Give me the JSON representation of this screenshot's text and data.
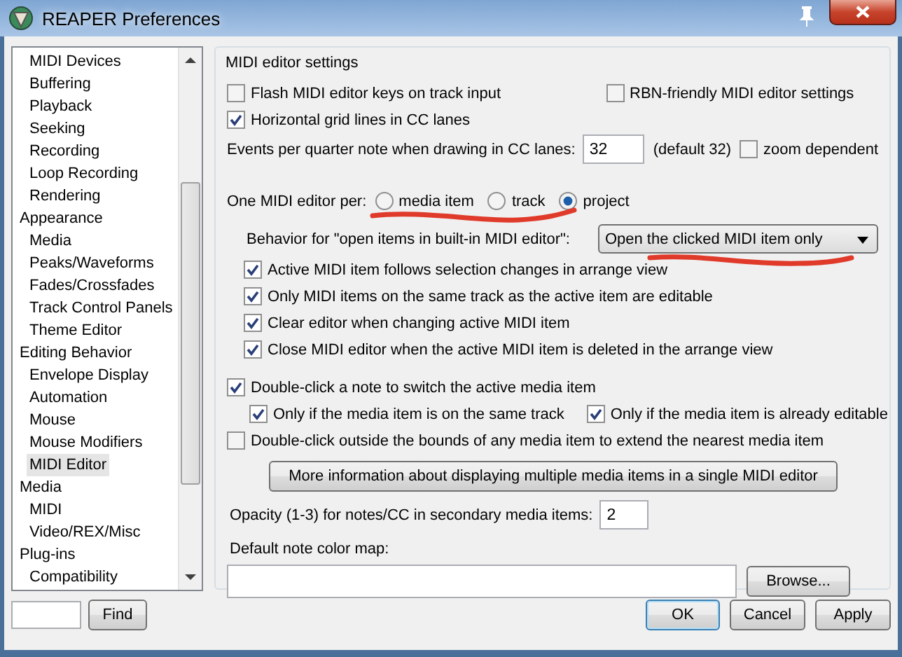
{
  "window": {
    "title": "REAPER Preferences"
  },
  "tree": [
    {
      "children": [
        {
          "label": "MIDI Devices",
          "selected": false
        },
        {
          "label": "Buffering",
          "selected": false
        },
        {
          "label": "Playback",
          "selected": false
        },
        {
          "label": "Seeking",
          "selected": false
        },
        {
          "label": "Recording",
          "selected": false
        },
        {
          "label": "Loop Recording",
          "selected": false
        },
        {
          "label": "Rendering",
          "selected": false
        }
      ]
    },
    {
      "label": "Appearance",
      "selected": false,
      "children": [
        {
          "label": "Media",
          "selected": false
        },
        {
          "label": "Peaks/Waveforms",
          "selected": false
        },
        {
          "label": "Fades/Crossfades",
          "selected": false
        },
        {
          "label": "Track Control Panels",
          "selected": false
        },
        {
          "label": "Theme Editor",
          "selected": false
        }
      ]
    },
    {
      "label": "Editing Behavior",
      "selected": false,
      "children": [
        {
          "label": "Envelope Display",
          "selected": false
        },
        {
          "label": "Automation",
          "selected": false
        },
        {
          "label": "Mouse",
          "selected": false
        },
        {
          "label": "Mouse Modifiers",
          "selected": false
        },
        {
          "label": "MIDI Editor",
          "selected": true
        }
      ]
    },
    {
      "label": "Media",
      "selected": false,
      "children": [
        {
          "label": "MIDI",
          "selected": false
        },
        {
          "label": "Video/REX/Misc",
          "selected": false
        }
      ]
    },
    {
      "label": "Plug-ins",
      "selected": false,
      "children": [
        {
          "label": "Compatibility",
          "selected": false
        }
      ]
    }
  ],
  "find": {
    "button": "Find"
  },
  "group": {
    "title": "MIDI editor settings"
  },
  "settings": [
    {
      "kind": "checks",
      "items": [
        {
          "label": "Flash MIDI editor keys on track input",
          "checked": false
        },
        {
          "label": "RBN-friendly MIDI editor settings",
          "checked": false
        }
      ]
    },
    {
      "kind": "checks",
      "items": [
        {
          "label": "Horizontal grid lines in CC lanes",
          "checked": true
        }
      ]
    },
    {
      "kind": "number",
      "label": "Events per quarter note when drawing in CC lanes:",
      "value": "32",
      "note": "(default 32)",
      "option": {
        "label": "zoom dependent",
        "checked": false
      }
    },
    {
      "kind": "radios",
      "label": "One MIDI editor per:",
      "options": [
        {
          "label": "media item",
          "selected": false
        },
        {
          "label": "track",
          "selected": false
        },
        {
          "label": "project",
          "selected": true
        }
      ]
    },
    {
      "kind": "dropdown",
      "label": "Behavior for \"open items in built-in MIDI editor\":",
      "value": "Open the clicked MIDI item only",
      "children": [
        {
          "label": "Active MIDI item follows selection changes in arrange view",
          "checked": true
        },
        {
          "label": "Only MIDI items on the same track as the active item are editable",
          "checked": true
        },
        {
          "label": "Clear editor when changing active MIDI item",
          "checked": true
        },
        {
          "label": "Close MIDI editor when the active MIDI item is deleted in the arrange view",
          "checked": true
        }
      ]
    },
    {
      "kind": "checks",
      "items": [
        {
          "label": "Double-click a note to switch the active media item",
          "checked": true,
          "children": [
            {
              "label": "Only if the media item is on the same track",
              "checked": true
            },
            {
              "label": "Only if the media item is already editable",
              "checked": true
            }
          ]
        }
      ]
    },
    {
      "kind": "checks",
      "items": [
        {
          "label": "Double-click outside the bounds of any media item to extend the nearest media item",
          "checked": false
        }
      ]
    },
    {
      "kind": "button",
      "label": "More information about displaying multiple media items in a single MIDI editor"
    },
    {
      "kind": "number",
      "label": "Opacity (1-3) for notes/CC in secondary media items:",
      "value": "2"
    },
    {
      "kind": "file",
      "label": "Default note color map:",
      "button": "Browse..."
    }
  ],
  "buttons": [
    {
      "label": "OK",
      "default": true
    },
    {
      "label": "Cancel",
      "default": false
    },
    {
      "label": "Apply",
      "default": false
    }
  ]
}
